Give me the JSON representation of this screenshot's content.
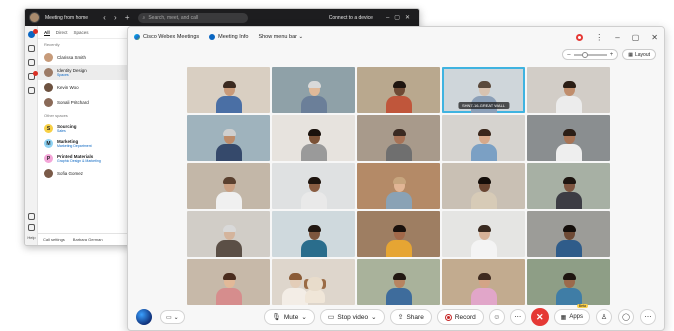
{
  "app": {
    "status_text": "Meeting from home",
    "search_placeholder": "Search, meet, and call",
    "connect_label": "Connect to a device",
    "tabs": [
      "All",
      "Direct",
      "Spaces"
    ],
    "section_recent": "Recently",
    "section_other": "Other spaces",
    "contacts": [
      {
        "name": "Clarissa Smith",
        "sub": "",
        "color": "#c79b7a"
      },
      {
        "name": "Identity Design",
        "sub": "Spaces",
        "color": "#9c7b66"
      },
      {
        "name": "Kevin Woo",
        "sub": "",
        "color": "#6d5240"
      },
      {
        "name": "Sonali Pritchard",
        "sub": "",
        "color": "#8a6a58"
      }
    ],
    "spaces": [
      {
        "letter": "S",
        "name": "Sourcing",
        "sub": "Sales",
        "color": "#f7d046"
      },
      {
        "letter": "M",
        "name": "Marketing",
        "sub": "Marketing Department",
        "color": "#8fd3f4"
      },
      {
        "letter": "P",
        "name": "Printed Materials",
        "sub": "Graphic Design & Marketing",
        "color": "#f3a6d8"
      },
      {
        "letter": "",
        "name": "Sofia Gomez",
        "sub": "",
        "color": "#7a5a48"
      }
    ],
    "footer_call_settings": "Call settings",
    "footer_user": "Barbara German",
    "help_label": "Help"
  },
  "meeting": {
    "brand": "Cisco Webex Meetings",
    "info": "Meeting Info",
    "menu": "Show menu bar",
    "layout_label": "Layout",
    "active_tile_label": "SHN7-16-GREAT WALL",
    "tiles": [
      {
        "bg": "#d9cfc2",
        "skin": "#c99a79",
        "hair": "#3b2a20",
        "shirt": "#4a6fa5"
      },
      {
        "bg": "#8fa1a8",
        "skin": "#e0b999",
        "hair": "#d9d9d9",
        "shirt": "#6b7f99"
      },
      {
        "bg": "#b9a88e",
        "skin": "#6e4a35",
        "hair": "#1e1510",
        "shirt": "#c0563b"
      },
      {
        "bg": "#cfd6da",
        "skin": "#d9c3b0",
        "hair": "#5b4a3c",
        "shirt": "#8ca0b8"
      },
      {
        "bg": "#d2cdc7",
        "skin": "#c08d6c",
        "hair": "#2a1d15",
        "shirt": "#ececec"
      },
      {
        "bg": "#9fb3bd",
        "skin": "#bd8b69",
        "hair": "#cfcfcf",
        "shirt": "#35496b"
      },
      {
        "bg": "#e7e3de",
        "skin": "#7b5237",
        "hair": "#1a120d",
        "shirt": "#9a9a9a"
      },
      {
        "bg": "#a89a8b",
        "skin": "#a77256",
        "hair": "#3a2a22",
        "shirt": "#6f6f6f"
      },
      {
        "bg": "#d6d3cf",
        "skin": "#d7a98a",
        "hair": "#3a261b",
        "shirt": "#7ba0c4"
      },
      {
        "bg": "#8a8e90",
        "skin": "#a87455",
        "hair": "#2b1e16",
        "shirt": "#eeeeee"
      },
      {
        "bg": "#c3b7a8",
        "skin": "#caa083",
        "hair": "#5a402f",
        "shirt": "#f0f0f0"
      },
      {
        "bg": "#dfe1e2",
        "skin": "#8a5d42",
        "hair": "#1e140e",
        "shirt": "#e9e9e9"
      },
      {
        "bg": "#b48a67",
        "skin": "#e1b595",
        "hair": "#c7a57e",
        "shirt": "#8aa2b5"
      },
      {
        "bg": "#c9c0b4",
        "skin": "#6a4632",
        "hair": "#140d09",
        "shirt": "#d7cbb7"
      },
      {
        "bg": "#a7b0a4",
        "skin": "#7e5540",
        "hair": "#1e1510",
        "shirt": "#3c3c44"
      },
      {
        "bg": "#d1cdc7",
        "skin": "#d4b49c",
        "hair": "#d9d9d9",
        "shirt": "#5b4f46"
      },
      {
        "bg": "#cfd9dd",
        "skin": "#7d563e",
        "hair": "#221812",
        "shirt": "#2a6d8c"
      },
      {
        "bg": "#9e7e62",
        "skin": "#a2694a",
        "hair": "#1a110c",
        "shirt": "#e6a533"
      },
      {
        "bg": "#e5e5e3",
        "skin": "#d6b298",
        "hair": "#3a2a20",
        "shirt": "#f4f4f4"
      },
      {
        "bg": "#9c9c98",
        "skin": "#6e4a35",
        "hair": "#140e0a",
        "shirt": "#2f5c8a"
      },
      {
        "bg": "#c7b9a9",
        "skin": "#e2b998",
        "hair": "#4a2c1e",
        "shirt": "#d68d8d"
      },
      {
        "bg": "#ded6cc",
        "skin": "#e3cdb8",
        "hair": "#8a5b36",
        "shirt": "#f3ede6",
        "dog": true
      },
      {
        "bg": "#a9b29b",
        "skin": "#b78461",
        "hair": "#221812",
        "shirt": "#3e6c9c"
      },
      {
        "bg": "#c2ab8f",
        "skin": "#d3a486",
        "hair": "#3f2b20",
        "shirt": "#e1a6c9"
      },
      {
        "bg": "#8e9e86",
        "skin": "#9c6a4c",
        "hair": "#1e1510",
        "shirt": "#3f7da6"
      }
    ]
  },
  "controls": {
    "mute": "Mute",
    "stop_video": "Stop video",
    "share": "Share",
    "record": "Record",
    "apps": "Apps",
    "beta": "Beta"
  }
}
